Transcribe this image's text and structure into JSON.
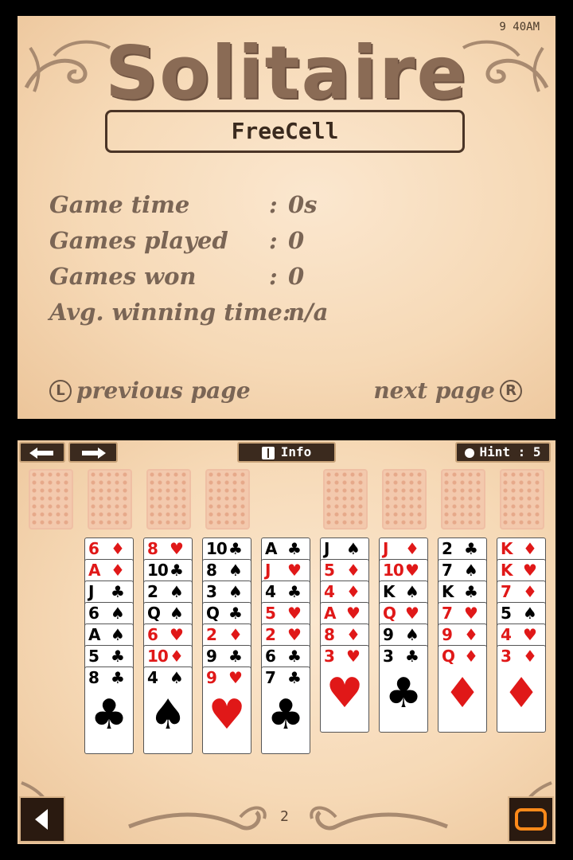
{
  "top_screen": {
    "clock": "9 40AM",
    "title": "Solitaire",
    "mode": "FreeCell",
    "stats": [
      {
        "label": "Game time",
        "value": "0s"
      },
      {
        "label": "Games played",
        "value": "0"
      },
      {
        "label": "Games won",
        "value": "0"
      },
      {
        "label": "Avg. winning time:",
        "value": "n/a"
      }
    ],
    "prev_key": "L",
    "prev_label": "previous page",
    "next_label": "next page",
    "next_key": "R"
  },
  "bottom_screen": {
    "undo_icon": "arrow-left-icon",
    "redo_icon": "arrow-right-icon",
    "info_label": "Info",
    "info_icon": "book-icon",
    "hint_label": "Hint : 5",
    "hint_icon": "lightbulb-icon",
    "page_number": "2",
    "back_icon": "triangle-left-icon",
    "menu_icon": "rounded-rect-icon",
    "free_cells": 4,
    "foundations": 4,
    "columns": [
      {
        "cards": [
          [
            "6",
            "♦",
            "red"
          ],
          [
            "A",
            "♦",
            "red"
          ],
          [
            "J",
            "♣",
            "black"
          ],
          [
            "6",
            "♠",
            "black"
          ],
          [
            "A",
            "♠",
            "black"
          ],
          [
            "5",
            "♣",
            "black"
          ],
          [
            "8",
            "♣",
            "black"
          ]
        ]
      },
      {
        "cards": [
          [
            "8",
            "♥",
            "red"
          ],
          [
            "10",
            "♣",
            "black"
          ],
          [
            "2",
            "♠",
            "black"
          ],
          [
            "Q",
            "♠",
            "black"
          ],
          [
            "6",
            "♥",
            "red"
          ],
          [
            "10",
            "♦",
            "red"
          ],
          [
            "4",
            "♠",
            "black"
          ]
        ]
      },
      {
        "cards": [
          [
            "10",
            "♣",
            "black"
          ],
          [
            "8",
            "♠",
            "black"
          ],
          [
            "3",
            "♠",
            "black"
          ],
          [
            "Q",
            "♣",
            "black"
          ],
          [
            "2",
            "♦",
            "red"
          ],
          [
            "9",
            "♣",
            "black"
          ],
          [
            "9",
            "♥",
            "red"
          ]
        ]
      },
      {
        "cards": [
          [
            "A",
            "♣",
            "black"
          ],
          [
            "J",
            "♥",
            "red"
          ],
          [
            "4",
            "♣",
            "black"
          ],
          [
            "5",
            "♥",
            "red"
          ],
          [
            "2",
            "♥",
            "red"
          ],
          [
            "6",
            "♣",
            "black"
          ],
          [
            "7",
            "♣",
            "black"
          ]
        ]
      },
      {
        "cards": [
          [
            "J",
            "♠",
            "black"
          ],
          [
            "5",
            "♦",
            "red"
          ],
          [
            "4",
            "♦",
            "red"
          ],
          [
            "A",
            "♥",
            "red"
          ],
          [
            "8",
            "♦",
            "red"
          ],
          [
            "3",
            "♥",
            "red"
          ]
        ]
      },
      {
        "cards": [
          [
            "J",
            "♦",
            "red"
          ],
          [
            "10",
            "♥",
            "red"
          ],
          [
            "K",
            "♠",
            "black"
          ],
          [
            "Q",
            "♥",
            "red"
          ],
          [
            "9",
            "♠",
            "black"
          ],
          [
            "3",
            "♣",
            "black"
          ]
        ]
      },
      {
        "cards": [
          [
            "2",
            "♣",
            "black"
          ],
          [
            "7",
            "♠",
            "black"
          ],
          [
            "K",
            "♣",
            "black"
          ],
          [
            "7",
            "♥",
            "red"
          ],
          [
            "9",
            "♦",
            "red"
          ],
          [
            "Q",
            "♦",
            "red"
          ]
        ]
      },
      {
        "cards": [
          [
            "K",
            "♦",
            "red"
          ],
          [
            "K",
            "♥",
            "red"
          ],
          [
            "7",
            "♦",
            "red"
          ],
          [
            "5",
            "♠",
            "black"
          ],
          [
            "4",
            "♥",
            "red"
          ],
          [
            "3",
            "♦",
            "red"
          ]
        ]
      }
    ]
  }
}
